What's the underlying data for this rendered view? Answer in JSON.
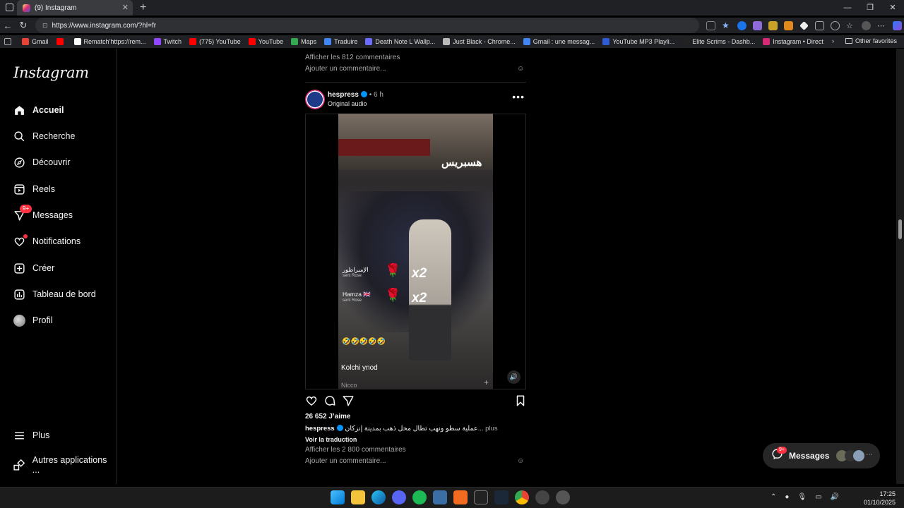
{
  "browser": {
    "tab_title": "(9) Instagram",
    "url": "https://www.instagram.com/?hl=fr",
    "bookmarks": [
      {
        "label": "Gmail",
        "color": "#ea4335"
      },
      {
        "label": "",
        "color": "#ff0000"
      },
      {
        "label": "Rematch’https://rem...",
        "color": "#ffffff"
      },
      {
        "label": "Twitch",
        "color": "#9146ff"
      },
      {
        "label": "(775) YouTube",
        "color": "#ff0000"
      },
      {
        "label": "YouTube",
        "color": "#ff0000"
      },
      {
        "label": "Maps",
        "color": "#34a853"
      },
      {
        "label": "Traduire",
        "color": "#4285f4"
      },
      {
        "label": "Death Note L Wallp...",
        "color": "#6b6bff"
      },
      {
        "label": "Just Black - Chrome...",
        "color": "#bbbbbb"
      },
      {
        "label": "Gmail : une messag...",
        "color": "#4285f4"
      },
      {
        "label": "YouTube MP3 Playli...",
        "color": "#2f5bd5"
      },
      {
        "label": "Elite Scrims - Dashb...",
        "color": "#222222"
      },
      {
        "label": "Instagram • Direct",
        "color": "#d62976"
      }
    ],
    "other_favorites": "Other favorites"
  },
  "sidebar": {
    "logo": "Instagram",
    "items": [
      {
        "label": "Accueil",
        "icon": "home-icon"
      },
      {
        "label": "Recherche",
        "icon": "search-icon"
      },
      {
        "label": "Découvrir",
        "icon": "compass-icon"
      },
      {
        "label": "Reels",
        "icon": "reels-icon"
      },
      {
        "label": "Messages",
        "icon": "send-icon",
        "badge": "9+"
      },
      {
        "label": "Notifications",
        "icon": "heart-icon"
      },
      {
        "label": "Créer",
        "icon": "plus-square-icon"
      },
      {
        "label": "Tableau de bord",
        "icon": "chart-icon"
      },
      {
        "label": "Profil",
        "icon": "avatar-icon"
      }
    ],
    "bottom": [
      {
        "label": "Plus",
        "icon": "menu-icon"
      },
      {
        "label": "Autres applications ...",
        "icon": "apps-icon"
      }
    ]
  },
  "prev_post": {
    "view_comments": "Afficher les 812 commentaires",
    "add_comment": "Ajouter un commentaire..."
  },
  "post": {
    "username": "hespress",
    "time": "6 h",
    "audio": "Original audio",
    "watermark": "هسبريس",
    "gift_1_name": "الإمبراطور",
    "gift_1_sub": "sent Rose",
    "gift_2_name": "Hamza 🇬🇧",
    "gift_2_sub": "sent Rose",
    "gift_count": "x2",
    "emoji_line": "🤣🤣🤣🤣🤣",
    "comment_overlay": "Kolchi ynod",
    "comment_overlay_2": "Nicco",
    "likes": "26 652 J’aime",
    "caption": "عملية سطو ونهب تطال محل ذهب بمدينة إنزكان...",
    "caption_more": "plus",
    "see_translation": "Voir la traduction",
    "view_comments": "Afficher les 2 800 commentaires",
    "add_comment": "Ajouter un commentaire..."
  },
  "floating_messages": {
    "label": "Messages",
    "badge": "9+"
  },
  "taskbar": {
    "time": "17:25",
    "date": "01/10/2025"
  },
  "colors": {
    "accent": "#0095f6",
    "badge": "#ff3040",
    "background": "#000000"
  }
}
